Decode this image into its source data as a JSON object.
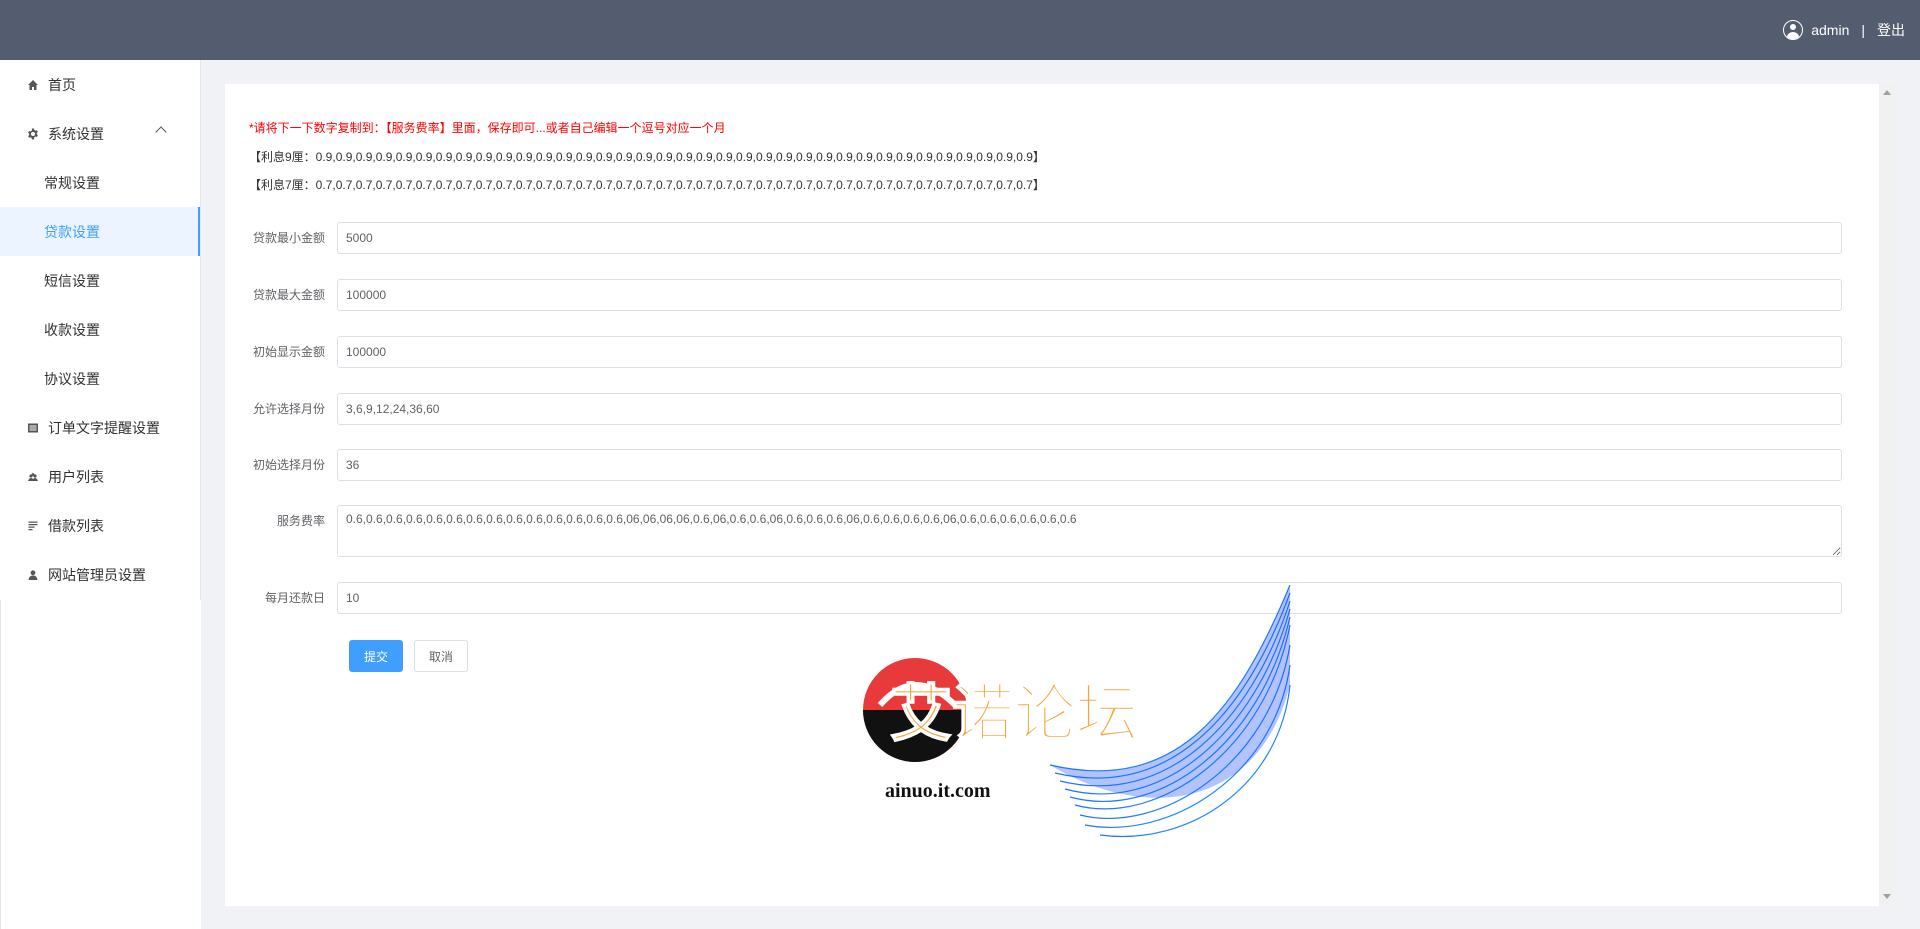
{
  "header": {
    "username": "admin",
    "separator": "|",
    "logout_label": "登出"
  },
  "sidebar": {
    "items": [
      {
        "label": "首页",
        "icon": "home-icon"
      },
      {
        "label": "系统设置",
        "icon": "gear-icon"
      },
      {
        "label": "常规设置"
      },
      {
        "label": "贷款设置"
      },
      {
        "label": "短信设置"
      },
      {
        "label": "收款设置"
      },
      {
        "label": "协议设置"
      },
      {
        "label": "订单文字提醒设置",
        "icon": "list-icon"
      },
      {
        "label": "用户列表",
        "icon": "users-icon"
      },
      {
        "label": "借款列表",
        "icon": "document-list-icon"
      },
      {
        "label": "网站管理员设置",
        "icon": "user-icon"
      }
    ]
  },
  "notice": {
    "text": "*请将下一下数字复制到：【服务费率】里面，保存即可...或者自己编辑一个逗号对应一个月",
    "rate9": "【利息9厘：0.9,0.9,0.9,0.9,0.9,0.9,0.9,0.9,0.9,0.9,0.9,0.9,0.9,0.9,0.9,0.9,0.9,0.9,0.9,0.9,0.9,0.9,0.9,0.9,0.9,0.9,0.9,0.9,0.9,0.9,0.9,0.9,0.9,0.9,0.9,0.9】",
    "rate7": "【利息7厘：0.7,0.7,0.7,0.7,0.7,0.7,0.7,0.7,0.7,0.7,0.7,0.7,0.7,0.7,0.7,0.7,0.7,0.7,0.7,0.7,0.7,0.7,0.7,0.7,0.7,0.7,0.7,0.7,0.7,0.7,0.7,0.7,0.7,0.7,0.7,0.7】"
  },
  "form": {
    "min_amount": {
      "label": "贷款最小金额",
      "value": "5000"
    },
    "max_amount": {
      "label": "贷款最大金额",
      "value": "100000"
    },
    "init_amount": {
      "label": "初始显示金额",
      "value": "100000"
    },
    "allowed_months": {
      "label": "允许选择月份",
      "value": "3,6,9,12,24,36,60"
    },
    "init_month": {
      "label": "初始选择月份",
      "value": "36"
    },
    "service_rate": {
      "label": "服务费率",
      "value": "0.6,0.6,0.6,0.6,0.6,0.6,0.6,0.6,0.6,0.6,0.6,0.6,0.6,0.6,06,06,06,06,0.6,06,0.6,0.6,06,0.6,0.6,0.6,06,0.6,0.6,0.6,0.6,06,0.6,0.6,0.6,0.6,0.6,0.6"
    },
    "repay_day": {
      "label": "每月还款日",
      "value": "10"
    },
    "submit_label": "提交",
    "cancel_label": "取消"
  },
  "watermark": {
    "title": "艾诺论坛",
    "url": "ainuo.it.com"
  }
}
